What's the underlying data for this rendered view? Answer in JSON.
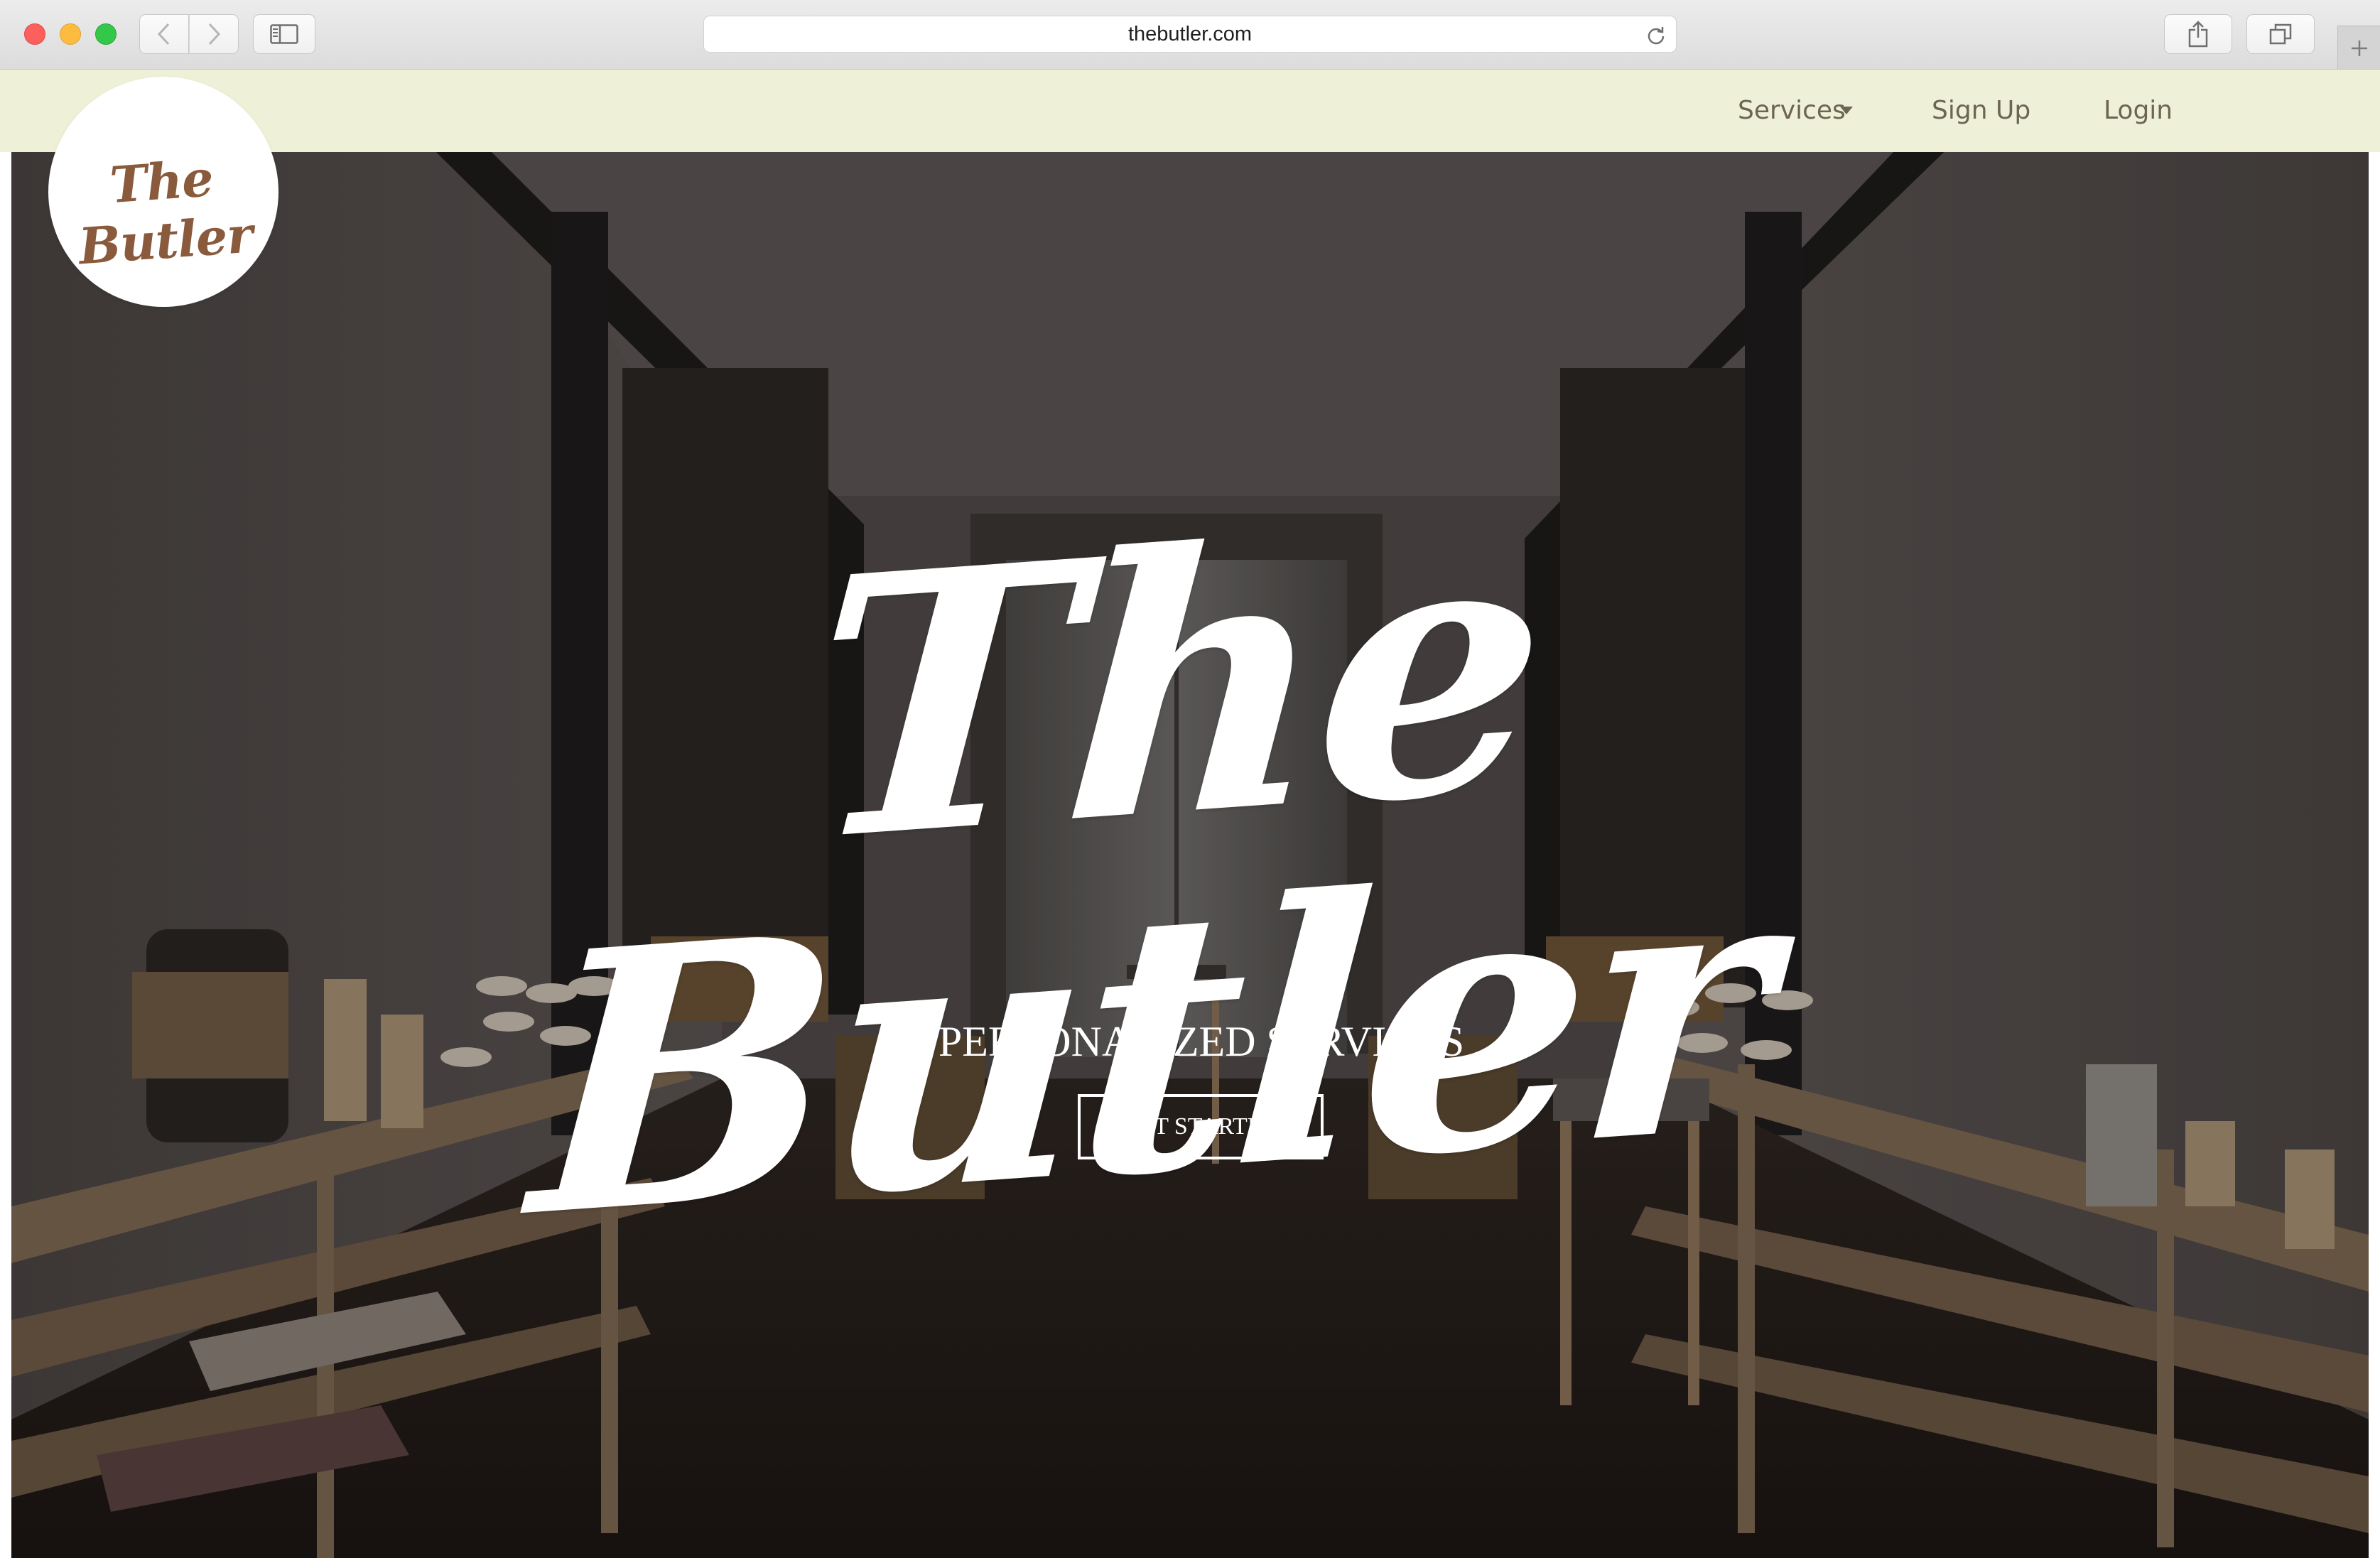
{
  "browser": {
    "url": "thebutler.com",
    "icons": {
      "back": "chevron-left-icon",
      "forward": "chevron-right-icon",
      "sidebar": "sidebar-icon",
      "reload": "reload-icon",
      "share": "share-icon",
      "tabs": "tabs-overview-icon",
      "new_tab": "plus-icon"
    }
  },
  "site": {
    "logo_text": "The Butler",
    "nav": {
      "services_label": "Services",
      "signup_label": "Sign Up",
      "login_label": "Login"
    },
    "hero": {
      "title": "The Butler",
      "subtitle": "PERSONALIZED SERVICES",
      "cta_label": "GET STARTED"
    },
    "colors": {
      "nav_background": "#eef1d8",
      "nav_text": "#6c6553",
      "logo_text": "#8a5a3c",
      "hero_text": "#ffffff"
    }
  }
}
